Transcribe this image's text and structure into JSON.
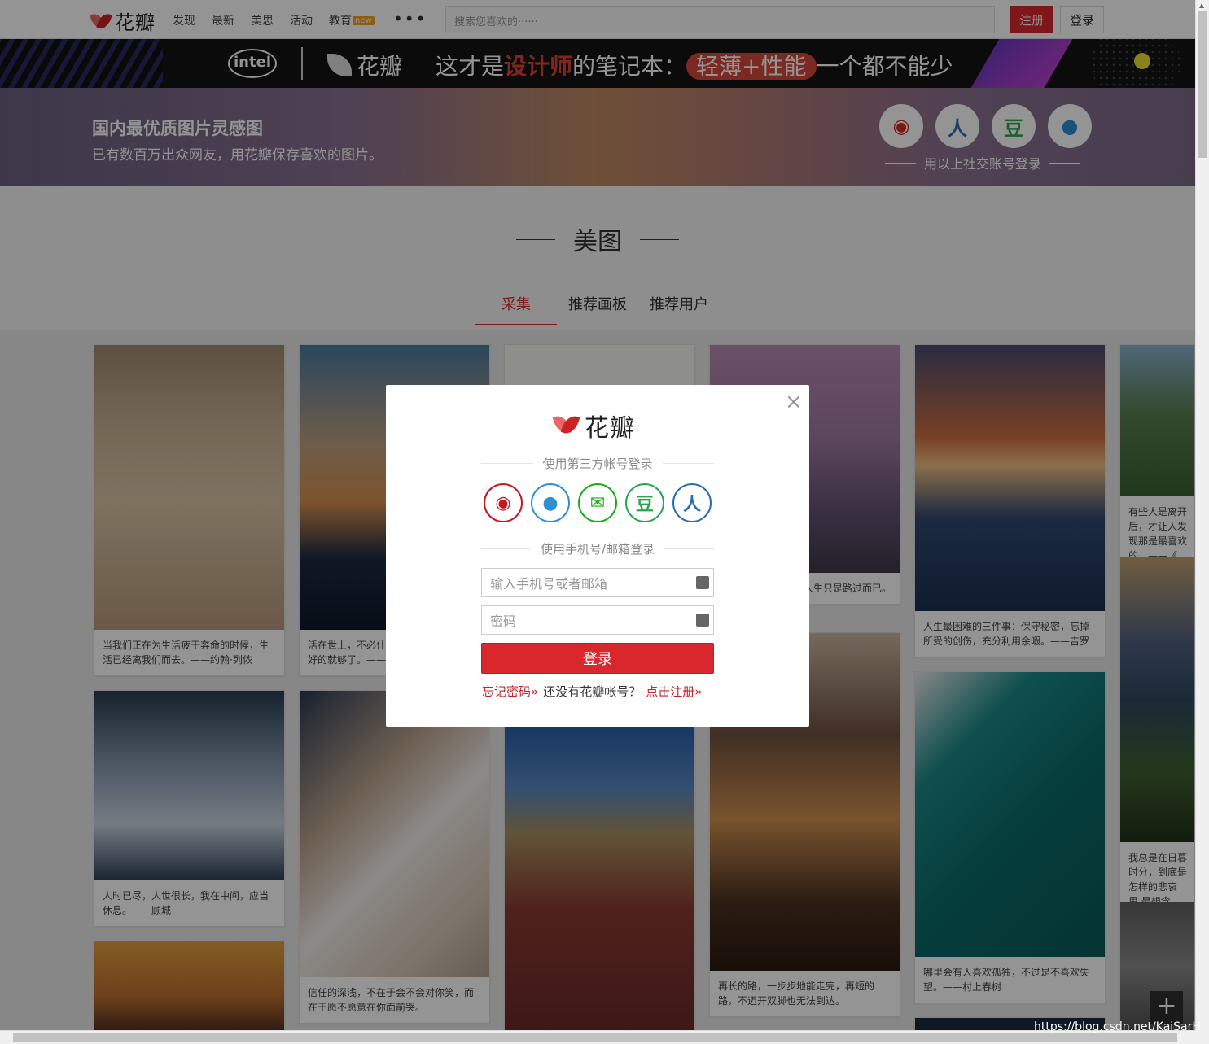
{
  "header": {
    "brand": "花瓣",
    "nav": [
      {
        "label": "发现"
      },
      {
        "label": "最新"
      },
      {
        "label": "美思"
      },
      {
        "label": "活动"
      },
      {
        "label": "教育",
        "badge": "new"
      }
    ],
    "more": "•••",
    "search_placeholder": "搜索您喜欢的······",
    "register_label": "注册",
    "login_label": "登录"
  },
  "banner": {
    "intel_logo": "intel",
    "brand": "花瓣",
    "slogan_pre": "这才是",
    "slogan_red": "设计师",
    "slogan_mid": "的笔记本：",
    "slogan_pill": "轻薄+性能",
    "slogan_post": "一个都不能少"
  },
  "hero": {
    "title": "国内最优质图片灵感图",
    "subtitle": "已有数百万出众网友，用花瓣保存喜欢的图片。",
    "social_note": "用以上社交账号登录",
    "social": [
      {
        "name": "weibo-icon",
        "glyph": "◉",
        "color": "#d52b1e"
      },
      {
        "name": "renren-icon",
        "glyph": "人",
        "color": "#2a6eb0"
      },
      {
        "name": "douban-icon",
        "glyph": "豆",
        "color": "#2ca34f"
      },
      {
        "name": "qq-icon",
        "glyph": "●",
        "color": "#2c90d0"
      }
    ]
  },
  "section": {
    "title": "美图",
    "tabs": [
      "采集",
      "推荐画板",
      "推荐用户"
    ],
    "active_tab": 0
  },
  "cards": [
    {
      "caption": "当我们正在为生活疲于奔命的时候，生活已经离我们而去。——约翰·列侬"
    },
    {
      "caption": "活在世上，不必什么都知道，只知道最好的就够了。——王小波"
    },
    {
      "caption": ""
    },
    {
      "caption": "人生只是路过而已。"
    },
    {
      "caption": "人生最困难的三件事：保守秘密，忘掉所受的创伤，充分利用余暇。——吉罗"
    },
    {
      "caption": "有些人是离开后，才让人发现那是最喜欢的。——《"
    },
    {
      "caption": "人时已尽，人世很长，我在中间，应当休息。——顾城"
    },
    {
      "caption": "信任的深浅，不在于会不会对你笑，而在于愿不愿意在你面前哭。"
    },
    {
      "caption": "再长的路，一步步地能走完，再短的路，不迈开双脚也无法到达。"
    },
    {
      "caption": "哪里会有人喜欢孤独，不过是不喜欢失望。——村上春树"
    },
    {
      "caption": "我总是在日暮时分，到底是怎样的悲哀里,最想念"
    }
  ],
  "modal": {
    "brand": "花瓣",
    "third_party_label": "使用第三方帐号登录",
    "social": [
      {
        "name": "weibo-icon",
        "glyph": "◉",
        "color": "#c8161d"
      },
      {
        "name": "qq-icon",
        "glyph": "●",
        "color": "#2c90d0"
      },
      {
        "name": "wechat-icon",
        "glyph": "✉",
        "color": "#1aad19"
      },
      {
        "name": "douban-icon",
        "glyph": "豆",
        "color": "#2ca34f"
      },
      {
        "name": "renren-icon",
        "glyph": "人",
        "color": "#2a6eb0"
      }
    ],
    "account_label": "使用手机号/邮箱登录",
    "account_placeholder": "输入手机号或者邮箱",
    "password_placeholder": "密码",
    "submit_label": "登录",
    "forgot_label": "忘记密码»",
    "no_account_label": "还没有花瓣帐号？",
    "register_link_label": "点击注册»",
    "close_glyph": "×"
  },
  "fab": {
    "glyph": "+"
  },
  "watermark": "https://blog.csdn.net/KaiSarH"
}
